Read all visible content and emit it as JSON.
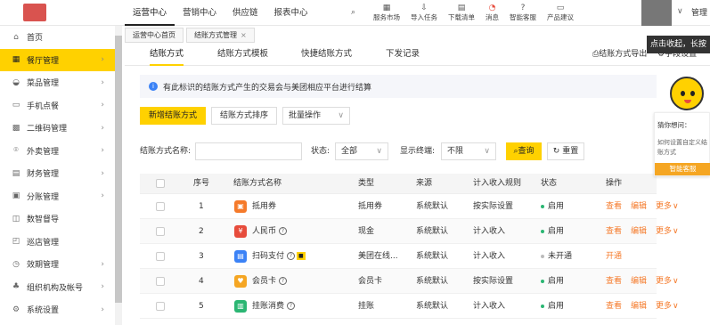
{
  "topbar": {
    "nav": [
      "运营中心",
      "营销中心",
      "供应链",
      "报表中心"
    ],
    "active_nav": 0,
    "tools": [
      {
        "label": "服务市场",
        "icon": "store-icon"
      },
      {
        "label": "导入任务",
        "icon": "import-icon"
      },
      {
        "label": "下载清单",
        "icon": "download-icon"
      },
      {
        "label": "消息",
        "icon": "bell-icon"
      },
      {
        "label": "智能客服",
        "icon": "help-icon"
      },
      {
        "label": "产品建议",
        "icon": "feedback-icon"
      }
    ],
    "username": "管理",
    "tooltip": "点击收起，长按"
  },
  "sidebar": {
    "items": [
      {
        "label": "首页",
        "icon": "home-icon",
        "arrow": false
      },
      {
        "label": "餐厅管理",
        "icon": "restaurant-icon",
        "arrow": true,
        "active": true
      },
      {
        "label": "菜品管理",
        "icon": "dish-icon",
        "arrow": true
      },
      {
        "label": "手机点餐",
        "icon": "phone-icon",
        "arrow": true
      },
      {
        "label": "二维码管理",
        "icon": "qrcode-icon",
        "arrow": true
      },
      {
        "label": "外卖管理",
        "icon": "delivery-icon",
        "arrow": true
      },
      {
        "label": "财务管理",
        "icon": "finance-icon",
        "arrow": true
      },
      {
        "label": "分账管理",
        "icon": "split-icon",
        "arrow": true
      },
      {
        "label": "数智督导",
        "icon": "supervise-icon",
        "arrow": false
      },
      {
        "label": "巡店管理",
        "icon": "inspect-icon",
        "arrow": false
      },
      {
        "label": "效期管理",
        "icon": "expiry-icon",
        "arrow": true
      },
      {
        "label": "组织机构及帐号",
        "icon": "org-icon",
        "arrow": true
      },
      {
        "label": "系统设置",
        "icon": "settings-icon",
        "arrow": true
      }
    ]
  },
  "page_tabs": [
    {
      "label": "运营中心首页",
      "closable": false
    },
    {
      "label": "结账方式管理",
      "closable": true,
      "close_glyph": "×"
    }
  ],
  "subtabs": [
    "结账方式",
    "结账方式模板",
    "快捷结账方式",
    "下发记录"
  ],
  "active_subtab": 0,
  "export_link": "结账方式导出",
  "field_settings": "字段设置",
  "info_text": "有此标识的结账方式产生的交易会与美团相应平台进行结算",
  "buttons": {
    "add": "新增结账方式",
    "sort": "结账方式排序",
    "batch": "批量操作"
  },
  "filters": {
    "name_label": "结账方式名称:",
    "name_value": "",
    "status_label": "状态:",
    "status_value": "全部",
    "terminal_label": "显示终端:",
    "terminal_value": "不限",
    "query": "查询",
    "reset": "重置"
  },
  "table": {
    "headers": [
      "序号",
      "结账方式名称",
      "类型",
      "来源",
      "计入收入规则",
      "状态",
      "操作"
    ],
    "rows": [
      {
        "no": "1",
        "name": "抵用券",
        "icon_color": "#f57a2a",
        "icon_glyph": "▣",
        "help": false,
        "badge": false,
        "type": "抵用券",
        "source": "系统默认",
        "rule": "按实际设置",
        "status": "启用",
        "status_color": "#2bb673",
        "actions": [
          "查看",
          "编辑",
          "更多"
        ]
      },
      {
        "no": "2",
        "name": "人民币",
        "icon_color": "#e74c3c",
        "icon_glyph": "¥",
        "help": true,
        "badge": false,
        "type": "现金",
        "source": "系统默认",
        "rule": "计入收入",
        "status": "启用",
        "status_color": "#2bb673",
        "actions": [
          "查看",
          "编辑",
          "更多"
        ]
      },
      {
        "no": "3",
        "name": "扫码支付",
        "icon_color": "#3b82f6",
        "icon_glyph": "▤",
        "help": true,
        "badge": true,
        "type": "美团在线...",
        "source": "系统默认",
        "rule": "计入收入",
        "status": "未开通",
        "status_color": "#bbbbbb",
        "actions": [
          "开通"
        ]
      },
      {
        "no": "4",
        "name": "会员卡",
        "icon_color": "#f5a623",
        "icon_glyph": "♥",
        "help": true,
        "badge": false,
        "type": "会员卡",
        "source": "系统默认",
        "rule": "按实际设置",
        "status": "启用",
        "status_color": "#2bb673",
        "actions": [
          "查看",
          "编辑",
          "更多"
        ]
      },
      {
        "no": "5",
        "name": "挂账消费",
        "icon_color": "#2bb673",
        "icon_glyph": "▥",
        "help": true,
        "badge": false,
        "type": "挂账",
        "source": "系统默认",
        "rule": "计入收入",
        "status": "启用",
        "status_color": "#2bb673",
        "actions": [
          "查看",
          "编辑",
          "更多"
        ]
      }
    ]
  },
  "assistant": {
    "title": "猜你想问：",
    "question": "如何设置自定义结账方式",
    "button": "智能客服"
  },
  "colors": {
    "accent": "#ffd100",
    "action": "#f57a2a",
    "enabled": "#2bb673"
  }
}
